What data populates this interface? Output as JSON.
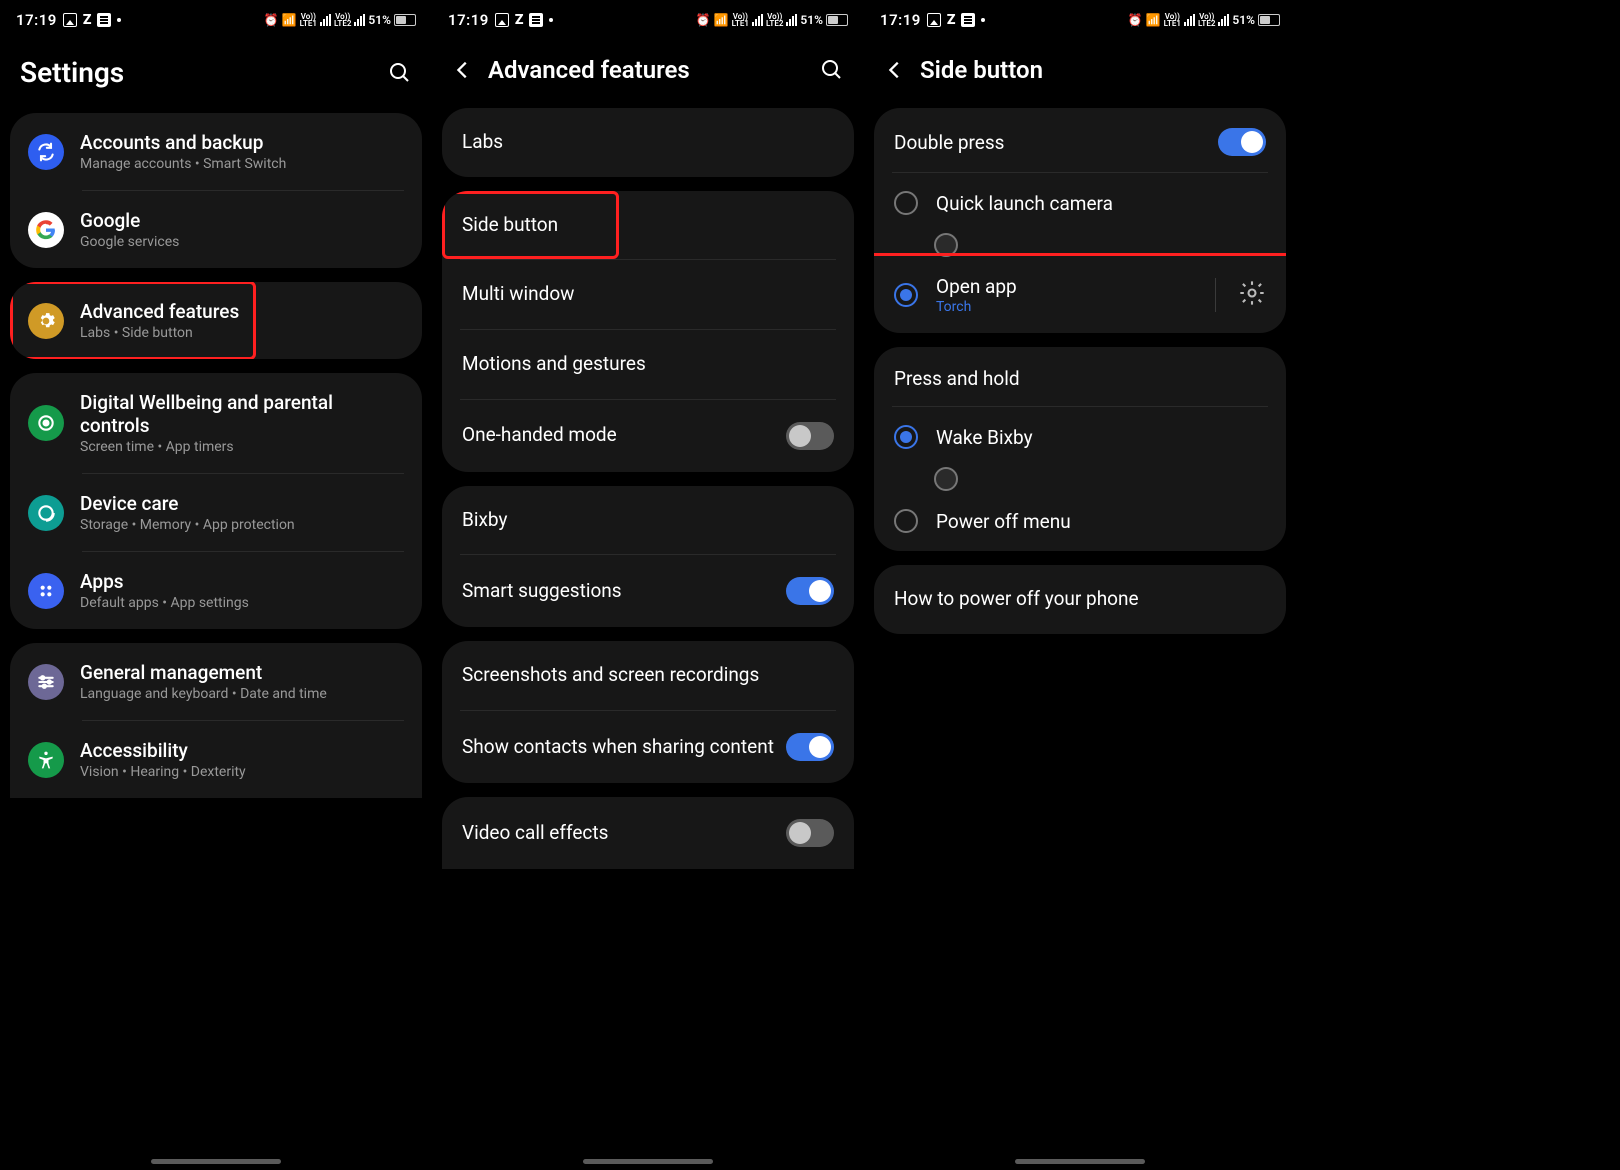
{
  "status": {
    "time": "17:19",
    "battery": "51%"
  },
  "screen1": {
    "title": "Settings",
    "highlight_index": 1,
    "groups": [
      [
        {
          "icon_bg": "#2e5ef0",
          "icon": "sync",
          "title": "Accounts and backup",
          "sub": "Manage accounts  •  Smart Switch"
        },
        {
          "icon_bg": "#fff",
          "icon": "google",
          "title": "Google",
          "sub": "Google services"
        }
      ],
      [
        {
          "icon_bg": "#d09a26",
          "icon": "advanced",
          "title": "Advanced features",
          "sub": "Labs  •  Side button"
        }
      ],
      [
        {
          "icon_bg": "#159a4a",
          "icon": "wellbeing",
          "title": "Digital Wellbeing and parental controls",
          "sub": "Screen time  •  App timers"
        },
        {
          "icon_bg": "#0d9d93",
          "icon": "devicecare",
          "title": "Device care",
          "sub": "Storage  •  Memory  •  App protection"
        },
        {
          "icon_bg": "#3a62f0",
          "icon": "apps",
          "title": "Apps",
          "sub": "Default apps  •  App settings"
        }
      ],
      [
        {
          "icon_bg": "#6d6896",
          "icon": "general",
          "title": "General management",
          "sub": "Language and keyboard  •  Date and time"
        },
        {
          "icon_bg": "#159a4a",
          "icon": "accessibility",
          "title": "Accessibility",
          "sub": "Vision  •  Hearing  •  Dexterity"
        }
      ]
    ]
  },
  "screen2": {
    "title": "Advanced features",
    "highlight_index": 1,
    "groups": [
      [
        {
          "label": "Labs"
        }
      ],
      [
        {
          "label": "Side button"
        },
        {
          "label": "Multi window"
        },
        {
          "label": "Motions and gestures"
        },
        {
          "label": "One-handed mode",
          "toggle": false
        }
      ],
      [
        {
          "label": "Bixby"
        },
        {
          "label": "Smart suggestions",
          "toggle": true
        }
      ],
      [
        {
          "label": "Screenshots and screen recordings"
        },
        {
          "label": "Show contacts when sharing content",
          "toggle": true
        }
      ],
      [
        {
          "label": "Video call effects",
          "toggle": false
        }
      ]
    ]
  },
  "screen3": {
    "title": "Side button",
    "sec1": {
      "title": "Double press",
      "options": [
        {
          "label": "Quick launch camera",
          "selected": false
        },
        {
          "label": "Open app",
          "sub": "Torch",
          "selected": true,
          "gear": true
        }
      ]
    },
    "sec2": {
      "title": "Press and hold",
      "options": [
        {
          "label": "Wake Bixby",
          "selected": true
        },
        {
          "label": "Power off menu",
          "selected": false
        }
      ]
    },
    "footer": "How to power off your phone"
  }
}
